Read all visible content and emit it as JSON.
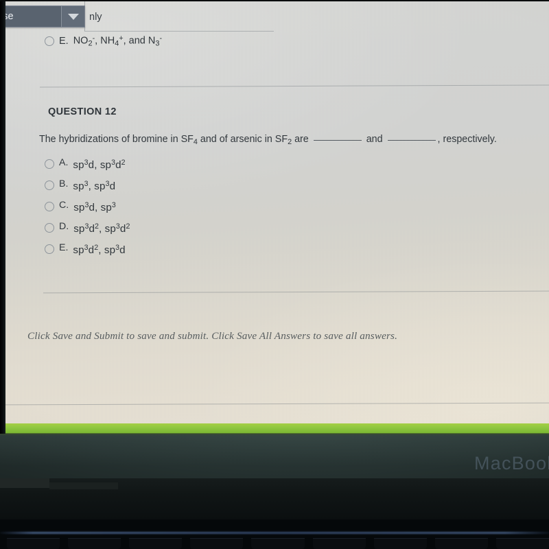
{
  "window": {
    "collapse_button_label": "ollapse",
    "dropdown_icon": "chevron-down-icon",
    "partial_text_right": "nly"
  },
  "previous_question": {
    "option_letter": "E.",
    "option_text_html": "NO<sub>2</sub><sup>-</sup>, NH<sub>4</sub><sup>+</sup>, and N<sub>3</sub><sup>-</sup>",
    "option_text_plain": "NO2-, NH4+, and N3-"
  },
  "question": {
    "number_label": "QUESTION 12",
    "prompt_part1": "The hybridizations of bromine in SF",
    "prompt_sub1": "4",
    "prompt_part2": " and of arsenic in SF",
    "prompt_sub2": "2",
    "prompt_part3": " are ",
    "prompt_part4": " and ",
    "prompt_part5": ", respectively.",
    "prompt_plain": "The hybridizations of bromine in SF4 and of arsenic in SF2 are ________ and ________, respectively.",
    "options": [
      {
        "letter": "A.",
        "formula_html": "sp<sup>3</sup>d, sp<sup>3</sup>d<sup>2</sup>",
        "formula_plain": "sp3d, sp3d2",
        "selected": false
      },
      {
        "letter": "B.",
        "formula_html": "sp<sup>3</sup>, sp<sup>3</sup>d",
        "formula_plain": "sp3, sp3d",
        "selected": false
      },
      {
        "letter": "C.",
        "formula_html": "sp<sup>3</sup>d, sp<sup>3</sup>",
        "formula_plain": "sp3d, sp3",
        "selected": false
      },
      {
        "letter": "D.",
        "formula_html": "sp<sup>3</sup>d<sup>2</sup>, sp<sup>3</sup>d<sup>2</sup>",
        "formula_plain": "sp3d2, sp3d2",
        "selected": false
      },
      {
        "letter": "E.",
        "formula_html": "sp<sup>3</sup>d<sup>2</sup>, sp<sup>3</sup>d",
        "formula_plain": "sp3d2, sp3d",
        "selected": false
      }
    ]
  },
  "footer": {
    "instruction": "Click Save and Submit to save and submit. Click Save All Answers to save all answers."
  },
  "device": {
    "brand_text": "MacBook"
  },
  "colors": {
    "accent_green": "#8dc63f",
    "button_slate": "#5a6472",
    "text_gray": "#32383d",
    "footer_gray": "#575d5f",
    "bezel_dark": "#253130"
  }
}
